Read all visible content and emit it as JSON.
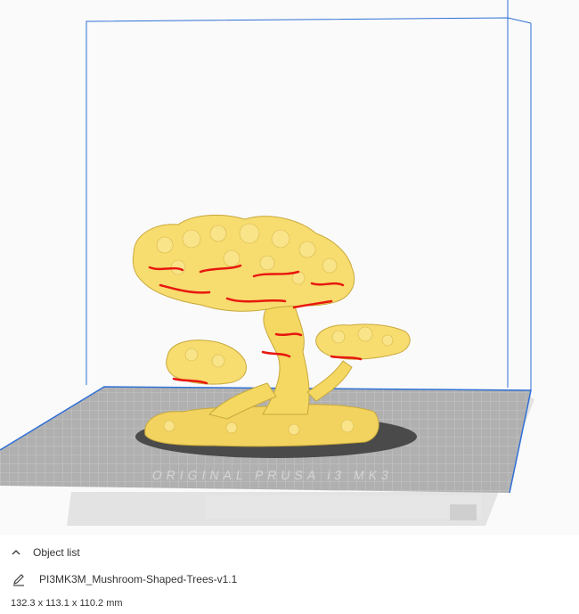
{
  "viewport": {
    "bed_brand_text": "ORIGINAL PRUSA i3 MK3",
    "colors": {
      "build_volume_lines": "#2f6fd6",
      "bed_surface": "#b4b4b4",
      "bed_grid": "#c9c9c9",
      "model": "#f7dc6f",
      "overhang": "#e8170f",
      "shadow": "#4a4a4a"
    }
  },
  "object_list": {
    "header_label": "Object list",
    "collapse_icon": "chevron-up-icon",
    "object_name": "PI3MK3M_Mushroom-Shaped-Trees-v1.1",
    "edit_icon": "pencil-icon",
    "dimensions": "132.3 x 113.1 x 110.2 mm"
  }
}
